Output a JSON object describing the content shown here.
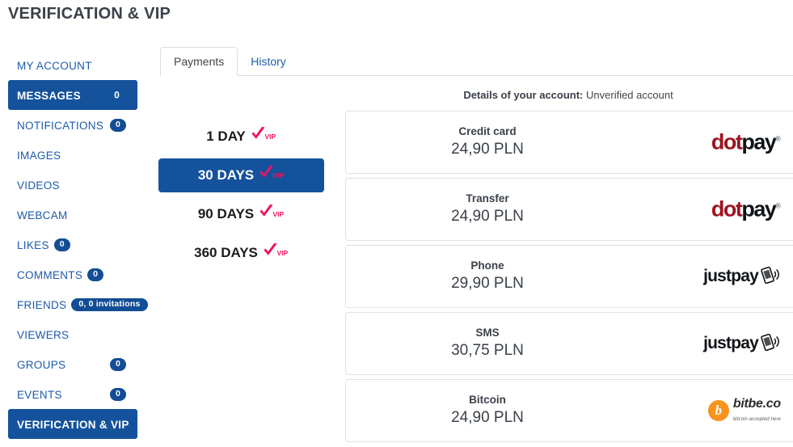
{
  "page": {
    "title": "VERIFICATION & VIP"
  },
  "sidebar": {
    "items": [
      {
        "label": "MY ACCOUNT",
        "badge": null,
        "badge_style": "none",
        "active": false
      },
      {
        "label": "MESSAGES",
        "badge": "0",
        "badge_style": "bare",
        "active": true
      },
      {
        "label": "NOTIFICATIONS",
        "badge": "0",
        "badge_style": "right",
        "active": false
      },
      {
        "label": "IMAGES",
        "badge": null,
        "badge_style": "none",
        "active": false
      },
      {
        "label": "VIDEOS",
        "badge": null,
        "badge_style": "none",
        "active": false
      },
      {
        "label": "WEBCAM",
        "badge": null,
        "badge_style": "none",
        "active": false
      },
      {
        "label": "LIKES",
        "badge": "0",
        "badge_style": "inline",
        "active": false
      },
      {
        "label": "COMMENTS",
        "badge": "0",
        "badge_style": "inline",
        "active": false
      },
      {
        "label": "FRIENDS",
        "badge": "0, 0 invitations",
        "badge_style": "inline-wide",
        "active": false
      },
      {
        "label": "VIEWERS",
        "badge": null,
        "badge_style": "none",
        "active": false
      },
      {
        "label": "GROUPS",
        "badge": "0",
        "badge_style": "right",
        "active": false
      },
      {
        "label": "EVENTS",
        "badge": "0",
        "badge_style": "right",
        "active": false
      },
      {
        "label": "VERIFICATION & VIP",
        "badge": null,
        "badge_style": "none",
        "active": true
      }
    ]
  },
  "tabs": [
    {
      "label": "Payments",
      "active": true
    },
    {
      "label": "History",
      "active": false
    }
  ],
  "details": {
    "label": "Details of your account:",
    "value": "Unverified account"
  },
  "durations": [
    {
      "label": "1 DAY",
      "vip": "VIP",
      "active": false
    },
    {
      "label": "30 DAYS",
      "vip": "VIP",
      "active": true
    },
    {
      "label": "90 DAYS",
      "vip": "VIP",
      "active": false
    },
    {
      "label": "360 DAYS",
      "vip": "VIP",
      "active": false
    }
  ],
  "payments": [
    {
      "name": "Credit card",
      "price": "24,90 PLN",
      "logo": "dotpay"
    },
    {
      "name": "Transfer",
      "price": "24,90 PLN",
      "logo": "dotpay"
    },
    {
      "name": "Phone",
      "price": "29,90 PLN",
      "logo": "justpay"
    },
    {
      "name": "SMS",
      "price": "30,75 PLN",
      "logo": "justpay"
    },
    {
      "name": "Bitcoin",
      "price": "24,90 PLN",
      "logo": "bitbe"
    }
  ],
  "logos": {
    "dotpay": {
      "part1": "dot",
      "part2": "pay",
      "reg": "®"
    },
    "justpay": {
      "text": "justpay"
    },
    "bitbe": {
      "symbol": "b",
      "name": "bitbe.co",
      "tagline": "bitcoin accepted here"
    }
  },
  "colors": {
    "brand_blue": "#15529c",
    "badge_blue": "#134d95",
    "link_blue": "#1d5bab",
    "vip_pink": "#f01361",
    "dotpay_red": "#9c1420",
    "bitbe_orange": "#f7941e"
  }
}
